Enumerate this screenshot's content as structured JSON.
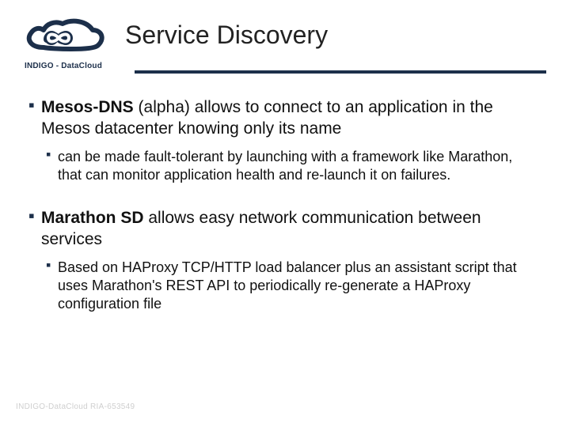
{
  "colors": {
    "accent": "#1c2f4a"
  },
  "logo": {
    "name": "infinity-cloud",
    "caption": "INDIGO - DataCloud"
  },
  "title": "Service Discovery",
  "bullets": [
    {
      "bold": "Mesos-DNS",
      "rest": " (alpha) allows to connect to an application in the Mesos datacenter knowing only its name",
      "children": [
        {
          "text": "can be made fault-tolerant by launching with a framework like Marathon, that can monitor application health and re-launch it on failures."
        }
      ]
    },
    {
      "bold": "Marathon SD",
      "rest": " allows easy network communication between services",
      "children": [
        {
          "text": "Based on HAProxy TCP/HTTP load balancer plus an assistant script that uses Marathon's REST API to periodically re-generate a HAProxy configuration file"
        }
      ]
    }
  ],
  "footer": "INDIGO-DataCloud RIA-653549"
}
